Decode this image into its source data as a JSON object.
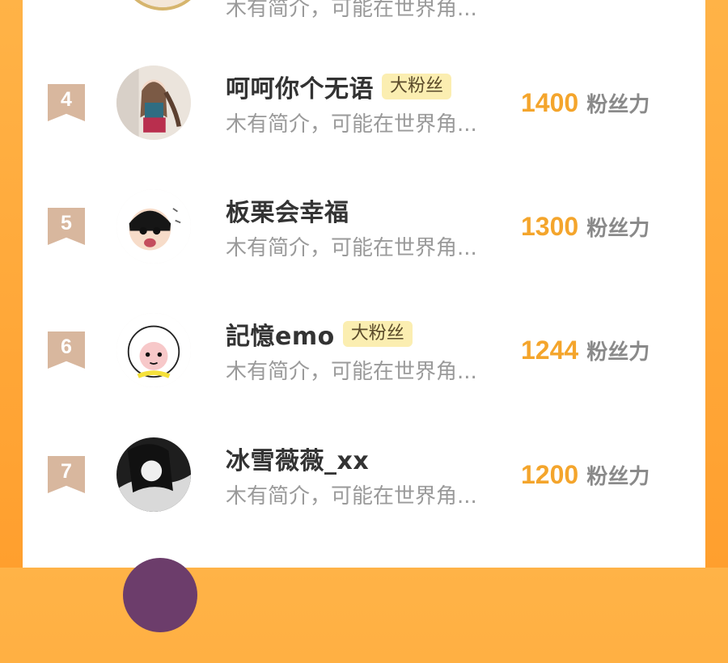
{
  "rows": [
    {
      "rank": "4",
      "name": "呵呵你个无语",
      "badge": "大粉丝",
      "bio": "木有简介，可能在世界角...",
      "score": "1400",
      "unit": "粉丝力"
    },
    {
      "rank": "5",
      "name": "板栗会幸福",
      "badge": "",
      "bio": "木有简介，可能在世界角...",
      "score": "1300",
      "unit": "粉丝力"
    },
    {
      "rank": "6",
      "name": "記憶emo",
      "badge": "大粉丝",
      "bio": "木有简介，可能在世界角...",
      "score": "1244",
      "unit": "粉丝力"
    },
    {
      "rank": "7",
      "name": "冰雪薇薇_xx",
      "badge": "",
      "bio": "木有简介，可能在世界角...",
      "score": "1200",
      "unit": "粉丝力"
    }
  ],
  "top_partial": {
    "bio": "木有简介，可能在世界角..."
  },
  "avatar_icons": [
    "girl-avatar-icon",
    "chibi-avatar-icon",
    "sheep-avatar-icon",
    "monochrome-avatar-icon"
  ],
  "colors": {
    "background": "#ff9f2e",
    "score": "#f4a52c",
    "badge_bg": "#fbeeb1",
    "rank_bg": "#d8b79e"
  }
}
